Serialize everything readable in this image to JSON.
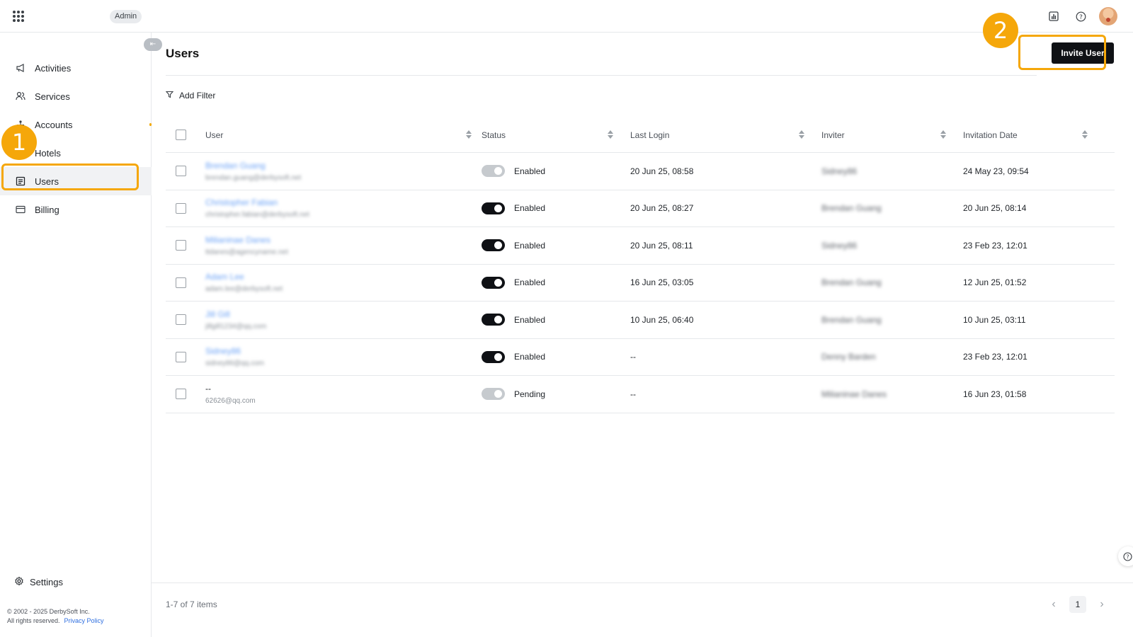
{
  "topbar": {
    "admin_badge": "Admin",
    "icons": [
      "apps-grid-icon",
      "report-icon",
      "help-icon",
      "avatar"
    ]
  },
  "sidebar": {
    "items": [
      {
        "label": "Activities",
        "icon": "megaphone-icon"
      },
      {
        "label": "Services",
        "icon": "people-icon"
      },
      {
        "label": "Accounts",
        "icon": "network-icon"
      },
      {
        "label": "Hotels",
        "icon": "building-icon"
      },
      {
        "label": "Users",
        "icon": "users-list-icon",
        "active": true
      },
      {
        "label": "Billing",
        "icon": "card-icon"
      }
    ],
    "settings_label": "Settings",
    "copyright_line1": "© 2002 - 2025 DerbySoft Inc.",
    "copyright_line2": "All rights reserved.",
    "privacy_link": "Privacy Policy"
  },
  "main": {
    "title": "Users",
    "invite_button": "Invite User",
    "add_filter": "Add Filter"
  },
  "table": {
    "columns": [
      "User",
      "Status",
      "Last Login",
      "Inviter",
      "Invitation Date"
    ],
    "rows": [
      {
        "user_name": "Brendan Guang",
        "user_email": "brendan.guang@derbysoft.net",
        "status": "Enabled",
        "enabled": false,
        "last_login": "20 Jun 25, 08:58",
        "inviter": "Sidney86",
        "invitation_date": "24 May 23, 09:54"
      },
      {
        "user_name": "Christopher Fabian",
        "user_email": "christopher.fabian@derbysoft.net",
        "status": "Enabled",
        "enabled": true,
        "last_login": "20 Jun 25, 08:27",
        "inviter": "Brendan Guang",
        "invitation_date": "20 Jun 25, 08:14"
      },
      {
        "user_name": "Milianinae Danes",
        "user_email": "ttdanes@agencyname.net",
        "status": "Enabled",
        "enabled": true,
        "last_login": "20 Jun 25, 08:11",
        "inviter": "Sidney86",
        "invitation_date": "23 Feb 23, 12:01"
      },
      {
        "user_name": "Adam Lee",
        "user_email": "adam.lee@derbysoft.net",
        "status": "Enabled",
        "enabled": true,
        "last_login": "16 Jun 25, 03:05",
        "inviter": "Brendan Guang",
        "invitation_date": "12 Jun 25, 01:52"
      },
      {
        "user_name": "Jill Gill",
        "user_email": "jillgill1234@qq.com",
        "status": "Enabled",
        "enabled": true,
        "last_login": "10 Jun 25, 06:40",
        "inviter": "Brendan Guang",
        "invitation_date": "10 Jun 25, 03:11"
      },
      {
        "user_name": "Sidney86",
        "user_email": "sidney86@qq.com",
        "status": "Enabled",
        "enabled": true,
        "last_login": "--",
        "inviter": "Denny Barden",
        "invitation_date": "23 Feb 23, 12:01"
      },
      {
        "user_name": "--",
        "user_email": "62626@qq.com",
        "status": "Pending",
        "enabled": false,
        "last_login": "--",
        "inviter": "Milianinae Danes",
        "invitation_date": "16 Jun 23, 01:58",
        "plain": true
      }
    ]
  },
  "pagination": {
    "summary": "1-7 of 7 items",
    "current_page": "1"
  },
  "annotations": {
    "step1": "1",
    "step2": "2",
    "color": "#f5a70a"
  }
}
